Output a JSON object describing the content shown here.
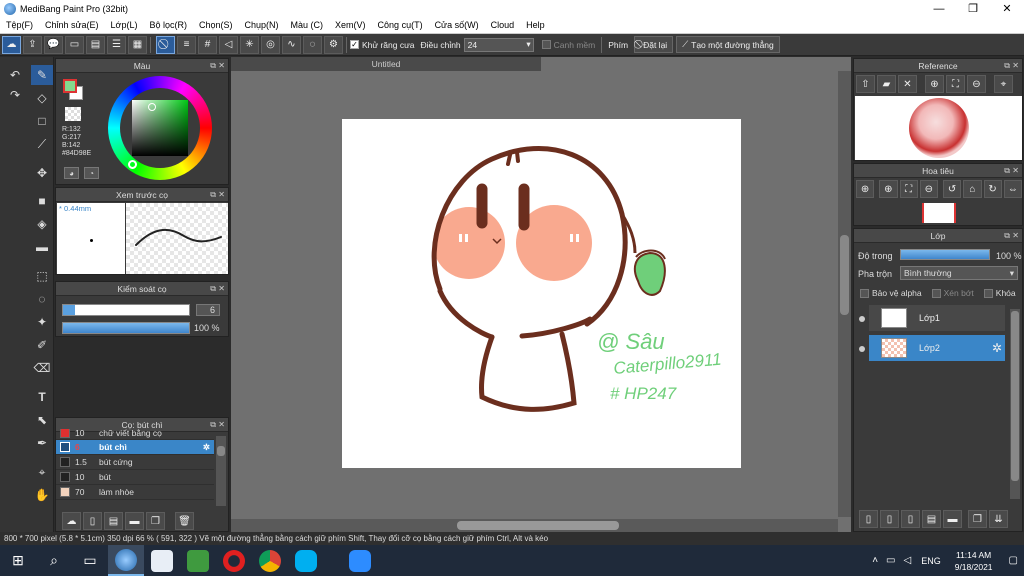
{
  "window": {
    "title": "MediBang Paint Pro (32bit)"
  },
  "menu": [
    "Tệp(F)",
    "Chỉnh sửa(E)",
    "Lớp(L)",
    "Bộ lọc(R)",
    "Chọn(S)",
    "Chụp(N)",
    "Màu (C)",
    "Xem(V)",
    "Công cụ(T)",
    "Cửa số(W)",
    "Cloud",
    "Help"
  ],
  "toolbar": {
    "antialias_label": "Khử răng cưa",
    "adjust_label": "Điều chỉnh",
    "adjust_value": "24",
    "edge_label": "Canh mềm",
    "key_label": "Phím",
    "reset_label": "Đặt lại",
    "line_label": "Tạo một đường thẳng"
  },
  "color_panel": {
    "title": "Màu",
    "r": "R:132",
    "g": "G:217",
    "b": "B:142",
    "hex": "#84D98E",
    "fg": "#84D98E",
    "bg": "#FFFFFF"
  },
  "preview_panel": {
    "title": "Xem trước cọ",
    "size": "0.44mm"
  },
  "control_panel": {
    "title": "Kiểm soát cọ",
    "size_value": "6",
    "opacity_value": "100 %",
    "opacity_fraction": 1.0
  },
  "brush_panel": {
    "title": "Cọ: bút chì",
    "items": [
      {
        "size": "10",
        "name": "chữ viết bằng cọ",
        "color": "#e03030"
      },
      {
        "size": "6",
        "name": "bút chì",
        "color": "#84D98E"
      },
      {
        "size": "1.5",
        "name": "bút cứng",
        "color": "#222222"
      },
      {
        "size": "10",
        "name": "bút",
        "color": "#222222"
      },
      {
        "size": "70",
        "name": "làm nhòe",
        "color": "#f3d3bd"
      }
    ]
  },
  "canvas": {
    "tab_title": "Untitled",
    "signature": [
      "@ Sâu",
      "Caterpillo2911",
      "# HP247"
    ]
  },
  "reference_panel": {
    "title": "Reference"
  },
  "navigator_panel": {
    "title": "Hoa tiêu"
  },
  "layer_panel": {
    "title": "Lớp",
    "opacity_label": "Độ trong",
    "opacity_value": "100 %",
    "opacity_fraction": 1.0,
    "blend_label": "Pha trộn",
    "blend_value": "Bình thường",
    "protect_alpha": "Bảo vệ alpha",
    "clipping": "Xén bớt",
    "lock": "Khóa",
    "layers": [
      {
        "name": "Lớp1"
      },
      {
        "name": "Lớp2"
      }
    ]
  },
  "statusbar": {
    "text": "800 * 700 pixel  (5.8 * 5.1cm)  350 dpi  66 %  ( 591, 322 )  Vẽ một đường thẳng bằng cách giữ phím Shift, Thay đổi cỡ cọ bằng cách giữ phím Ctrl, Alt và kéo"
  },
  "taskbar": {
    "lang": "ENG",
    "time": "11:14 AM",
    "date": "9/18/2021"
  }
}
